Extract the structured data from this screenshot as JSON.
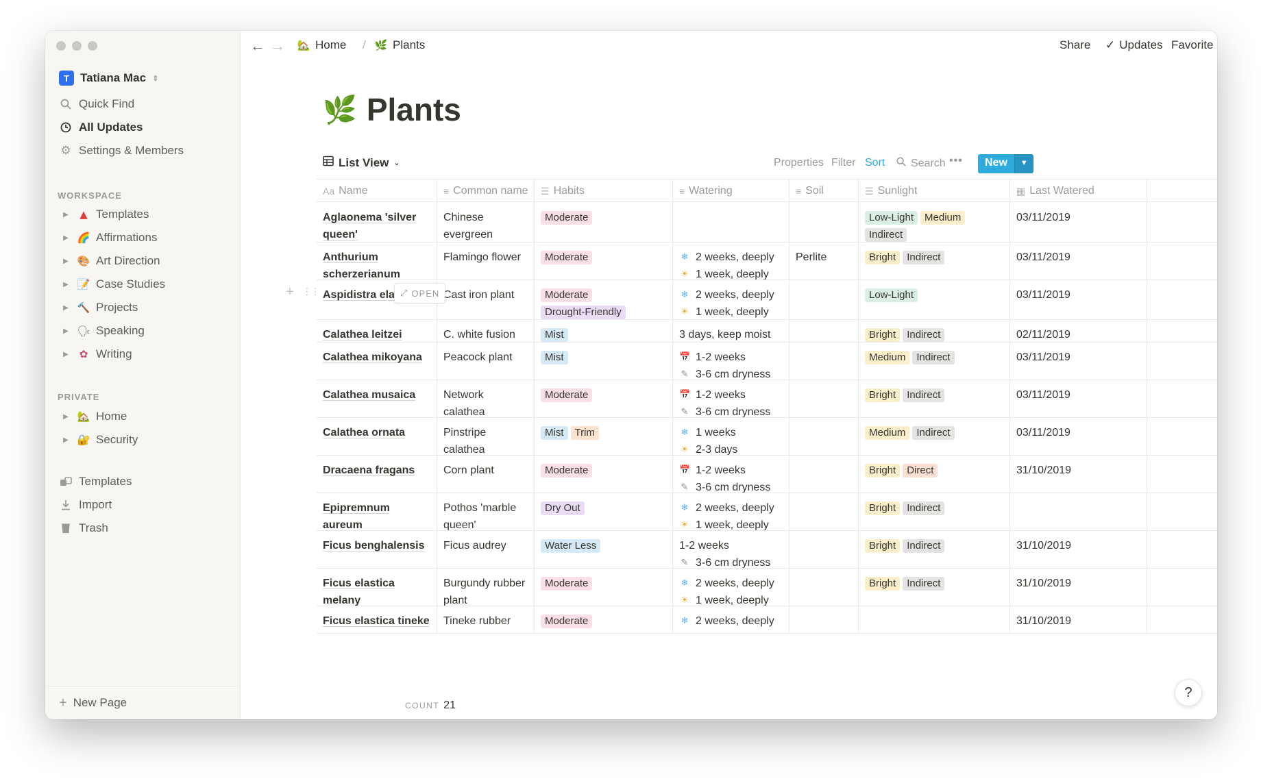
{
  "sidebar": {
    "workspace_name": "Tatiana Mac",
    "workspace_initial": "T",
    "top_items": [
      {
        "label": "Quick Find",
        "icon": "search-icon"
      },
      {
        "label": "All Updates",
        "icon": "clock-icon"
      },
      {
        "label": "Settings & Members",
        "icon": "gear-icon"
      }
    ],
    "workspace_section": "WORKSPACE",
    "workspace_pages": [
      {
        "label": "Templates",
        "emoji": "🔺"
      },
      {
        "label": "Affirmations",
        "emoji": "🌈"
      },
      {
        "label": "Art Direction",
        "emoji": "🎨"
      },
      {
        "label": "Case Studies",
        "emoji": "📝"
      },
      {
        "label": "Projects",
        "emoji": "🔨"
      },
      {
        "label": "Speaking",
        "emoji": "🗣"
      },
      {
        "label": "Writing",
        "emoji": "✎"
      }
    ],
    "private_section": "PRIVATE",
    "private_pages": [
      {
        "label": "Home",
        "emoji": "🏡"
      },
      {
        "label": "Security",
        "emoji": "🔐"
      }
    ],
    "bottom_items": [
      {
        "label": "Templates",
        "icon": "templates-icon"
      },
      {
        "label": "Import",
        "icon": "import-icon"
      },
      {
        "label": "Trash",
        "icon": "trash-icon"
      }
    ],
    "new_page": "New Page"
  },
  "topbar": {
    "breadcrumb": [
      {
        "label": "Home",
        "emoji": "🏡"
      },
      {
        "label": "Plants",
        "emoji": "🌿"
      }
    ],
    "share": "Share",
    "updates": "Updates",
    "favorite": "Favorite",
    "more": "•••"
  },
  "page": {
    "title": "Plants",
    "icon": "🌿"
  },
  "viewbar": {
    "view_name": "List View",
    "properties": "Properties",
    "filter": "Filter",
    "sort": "Sort",
    "search": "Search",
    "more": "•••",
    "new": "New"
  },
  "columns": [
    "Name",
    "Common name",
    "Habits",
    "Watering",
    "Soil",
    "Sunlight",
    "Last Watered"
  ],
  "tag_colors": {
    "Moderate": "#fbdfe6",
    "Mist": "#d6e9f6",
    "Trim": "#fbe3cf",
    "Drought-Friendly": "#e9ddf6",
    "Dry Out": "#e9ddf6",
    "Water Less": "#d6e9f6",
    "Low-Light": "#dcefe4",
    "Medium": "#fbeecb",
    "Indirect": "#e4e3e1",
    "Bright": "#fbeecb",
    "Direct": "#fbdfd3"
  },
  "rows": [
    {
      "name": "Aglaonema 'silver queen'",
      "common": "Chinese evergreen",
      "habits": [
        "Moderate"
      ],
      "watering": [],
      "soil": "",
      "sunlight": [
        "Low-Light",
        "Medium",
        "Indirect"
      ],
      "last": "03/11/2019"
    },
    {
      "name": "Anthurium scherzerianum",
      "common": "Flamingo flower",
      "habits": [
        "Moderate"
      ],
      "watering": [
        {
          "icon": "❄",
          "text": "2 weeks, deeply"
        },
        {
          "icon": "☀",
          "text": "1 week, deeply"
        }
      ],
      "soil": "Perlite",
      "sunlight": [
        "Bright",
        "Indirect"
      ],
      "last": "03/11/2019"
    },
    {
      "name": "Aspidistra elat",
      "common": "Cast iron plant",
      "habits": [
        "Moderate",
        "Drought-Friendly"
      ],
      "watering": [
        {
          "icon": "❄",
          "text": "2 weeks, deeply"
        },
        {
          "icon": "☀",
          "text": "1 week, deeply"
        }
      ],
      "soil": "",
      "sunlight": [
        "Low-Light"
      ],
      "last": "03/11/2019",
      "open_label": "OPEN"
    },
    {
      "name": "Calathea leitzei",
      "common": "C. white fusion",
      "habits": [
        "Mist"
      ],
      "watering": [
        {
          "icon": "",
          "text": "3 days, keep moist"
        }
      ],
      "soil": "",
      "sunlight": [
        "Bright",
        "Indirect"
      ],
      "last": "02/11/2019"
    },
    {
      "name": "Calathea mikoyana",
      "common": "Peacock plant",
      "habits": [
        "Mist"
      ],
      "watering": [
        {
          "icon": "📅",
          "text": "1-2 weeks"
        },
        {
          "icon": "✎",
          "text": "3-6 cm dryness"
        }
      ],
      "soil": "",
      "sunlight": [
        "Medium",
        "Indirect"
      ],
      "last": "03/11/2019"
    },
    {
      "name": "Calathea musaica",
      "common": "Network calathea",
      "habits": [
        "Moderate"
      ],
      "watering": [
        {
          "icon": "📅",
          "text": "1-2 weeks"
        },
        {
          "icon": "✎",
          "text": "3-6 cm dryness"
        }
      ],
      "soil": "",
      "sunlight": [
        "Bright",
        "Indirect"
      ],
      "last": "03/11/2019"
    },
    {
      "name": "Calathea ornata",
      "common": "Pinstripe calathea",
      "habits": [
        "Mist",
        "Trim"
      ],
      "watering": [
        {
          "icon": "❄",
          "text": "1 weeks"
        },
        {
          "icon": "☀",
          "text": "2-3 days"
        }
      ],
      "soil": "",
      "sunlight": [
        "Medium",
        "Indirect"
      ],
      "last": "03/11/2019"
    },
    {
      "name": "Dracaena fragans",
      "common": "Corn plant",
      "habits": [
        "Moderate"
      ],
      "watering": [
        {
          "icon": "📅",
          "text": "1-2 weeks"
        },
        {
          "icon": "✎",
          "text": "3-6 cm dryness"
        }
      ],
      "soil": "",
      "sunlight": [
        "Bright",
        "Direct"
      ],
      "last": "31/10/2019"
    },
    {
      "name": "Epipremnum aureum 'scindapeus'",
      "common": "Pothos 'marble queen'",
      "habits": [
        "Dry Out"
      ],
      "watering": [
        {
          "icon": "❄",
          "text": "2 weeks, deeply"
        },
        {
          "icon": "☀",
          "text": "1 week, deeply"
        }
      ],
      "soil": "",
      "sunlight": [
        "Bright",
        "Indirect"
      ],
      "last": ""
    },
    {
      "name": "Ficus benghalensis",
      "common": "Ficus audrey",
      "habits": [
        "Water Less"
      ],
      "watering": [
        {
          "icon": "",
          "text": "1-2 weeks"
        },
        {
          "icon": "✎",
          "text": "3-6 cm dryness"
        }
      ],
      "soil": "",
      "sunlight": [
        "Bright",
        "Indirect"
      ],
      "last": "31/10/2019"
    },
    {
      "name": "Ficus elastica melany",
      "common": "Burgundy rubber plant",
      "habits": [
        "Moderate"
      ],
      "watering": [
        {
          "icon": "❄",
          "text": "2 weeks, deeply"
        },
        {
          "icon": "☀",
          "text": "1 week, deeply"
        }
      ],
      "soil": "",
      "sunlight": [
        "Bright",
        "Indirect"
      ],
      "last": "31/10/2019"
    },
    {
      "name": "Ficus elastica tineke",
      "common": "Tineke rubber",
      "habits": [
        "Moderate"
      ],
      "watering": [
        {
          "icon": "❄",
          "text": "2 weeks, deeply"
        }
      ],
      "soil": "",
      "sunlight": [],
      "last": "31/10/2019"
    }
  ],
  "footer": {
    "count_label": "COUNT",
    "count_value": "21",
    "help": "?"
  }
}
